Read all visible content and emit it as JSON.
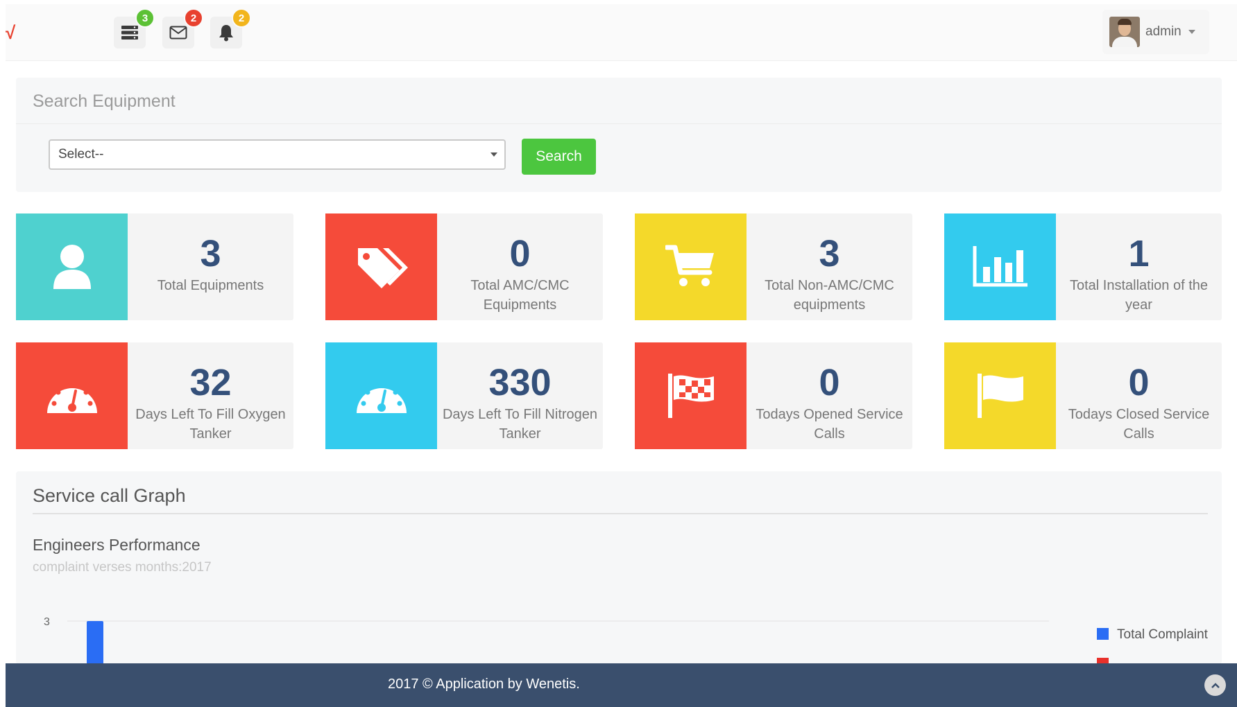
{
  "topbar": {
    "brand_mark": "√",
    "notifications": [
      {
        "name": "server-icon",
        "count": "3",
        "badge_color": "#5cc135"
      },
      {
        "name": "envelope-icon",
        "count": "2",
        "badge_color": "#e8412f"
      },
      {
        "name": "bell-icon",
        "count": "2",
        "badge_color": "#f2b51c"
      }
    ],
    "user": {
      "name": "admin"
    }
  },
  "search": {
    "title": "Search Equipment",
    "select_value": "Select--",
    "button_label": "Search"
  },
  "stats": [
    {
      "value": "3",
      "label": "Total Equipments",
      "icon": "user-icon",
      "color": "#4fd1cf"
    },
    {
      "value": "0",
      "label": "Total AMC/CMC Equipments",
      "icon": "tags-icon",
      "color": "#f54b3a"
    },
    {
      "value": "3",
      "label": "Total Non-AMC/CMC equipments",
      "icon": "cart-icon",
      "color": "#f4d92a"
    },
    {
      "value": "1",
      "label": "Total Installation of the year",
      "icon": "bar-chart-icon",
      "color": "#33cbee"
    },
    {
      "value": "32",
      "label": "Days Left To Fill Oxygen Tanker",
      "icon": "gauge-icon",
      "color": "#f54b3a"
    },
    {
      "value": "330",
      "label": "Days Left To Fill Nitrogen Tanker",
      "icon": "gauge-icon",
      "color": "#33cbee"
    },
    {
      "value": "0",
      "label": "Todays Opened Service Calls",
      "icon": "checkered-flag-icon",
      "color": "#f54b3a"
    },
    {
      "value": "0",
      "label": "Todays Closed Service Calls",
      "icon": "flag-icon",
      "color": "#f4d92a"
    }
  ],
  "graph": {
    "section_title": "Service call Graph",
    "chart_title": "Engineers Performance",
    "chart_subtitle": "complaint verses months:2017"
  },
  "chart_data": {
    "type": "bar",
    "title": "Engineers Performance",
    "subtitle": "complaint verses months:2017",
    "y_tick_labels": [
      "3"
    ],
    "series": [
      {
        "name": "Total Complaints",
        "color": "#2a6df4",
        "values": [
          3
        ]
      }
    ],
    "legend_position": "right",
    "grid": true
  },
  "footer": {
    "text": "2017 © Application by Wenetis."
  }
}
